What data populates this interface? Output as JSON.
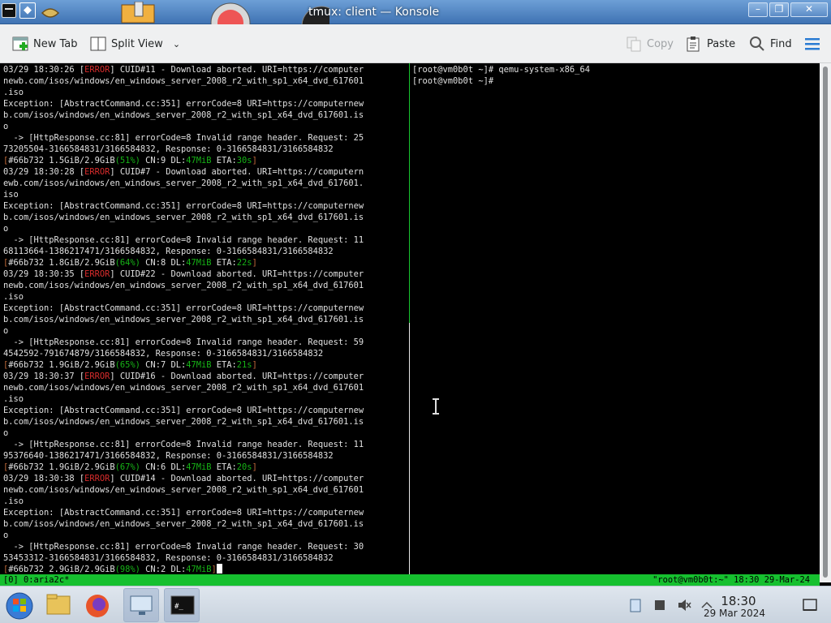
{
  "window": {
    "title": "tmux: client — Konsole"
  },
  "toolbar": {
    "new_tab": "New Tab",
    "split_view": "Split View",
    "copy": "Copy",
    "paste": "Paste",
    "find": "Find"
  },
  "left_pane": {
    "lines": [
      [
        [
          "03/29 18:30:26 [",
          ""
        ],
        [
          "ERROR",
          "err"
        ],
        [
          "] CUID#11 - Download aborted. URI=https://computer",
          ""
        ]
      ],
      [
        [
          "newb.com/isos/windows/en_windows_server_2008_r2_with_sp1_x64_dvd_617601",
          ""
        ]
      ],
      [
        [
          ".iso",
          ""
        ]
      ],
      [
        [
          "Exception: [AbstractCommand.cc:351] errorCode=8 URI=https://computernew",
          ""
        ]
      ],
      [
        [
          "b.com/isos/windows/en_windows_server_2008_r2_with_sp1_x64_dvd_617601.is",
          ""
        ]
      ],
      [
        [
          "o",
          ""
        ]
      ],
      [
        [
          "  -> [HttpResponse.cc:81] errorCode=8 Invalid range header. Request: 25",
          ""
        ]
      ],
      [
        [
          "73205504-3166584831/3166584832, Response: 0-3166584831/3166584832",
          ""
        ]
      ],
      [
        [
          "[",
          "br"
        ],
        [
          "#66b732 1.5GiB/2.9GiB",
          ""
        ],
        [
          "(51%)",
          "grn"
        ],
        [
          " CN:9 DL:",
          ""
        ],
        [
          "47MiB",
          "grn"
        ],
        [
          " ETA:",
          ""
        ],
        [
          "30s",
          "grn"
        ],
        [
          "]",
          "br"
        ]
      ],
      [
        [
          "03/29 18:30:28 [",
          ""
        ],
        [
          "ERROR",
          "err"
        ],
        [
          "] CUID#7 - Download aborted. URI=https://computern",
          ""
        ]
      ],
      [
        [
          "ewb.com/isos/windows/en_windows_server_2008_r2_with_sp1_x64_dvd_617601.",
          ""
        ]
      ],
      [
        [
          "iso",
          ""
        ]
      ],
      [
        [
          "Exception: [AbstractCommand.cc:351] errorCode=8 URI=https://computernew",
          ""
        ]
      ],
      [
        [
          "b.com/isos/windows/en_windows_server_2008_r2_with_sp1_x64_dvd_617601.is",
          ""
        ]
      ],
      [
        [
          "o",
          ""
        ]
      ],
      [
        [
          "  -> [HttpResponse.cc:81] errorCode=8 Invalid range header. Request: 11",
          ""
        ]
      ],
      [
        [
          "68113664-1386217471/3166584832, Response: 0-3166584831/3166584832",
          ""
        ]
      ],
      [
        [
          "[",
          "br"
        ],
        [
          "#66b732 1.8GiB/2.9GiB",
          ""
        ],
        [
          "(64%)",
          "grn"
        ],
        [
          " CN:8 DL:",
          ""
        ],
        [
          "47MiB",
          "grn"
        ],
        [
          " ETA:",
          ""
        ],
        [
          "22s",
          "grn"
        ],
        [
          "]",
          "br"
        ]
      ],
      [
        [
          "03/29 18:30:35 [",
          ""
        ],
        [
          "ERROR",
          "err"
        ],
        [
          "] CUID#22 - Download aborted. URI=https://computer",
          ""
        ]
      ],
      [
        [
          "newb.com/isos/windows/en_windows_server_2008_r2_with_sp1_x64_dvd_617601",
          ""
        ]
      ],
      [
        [
          ".iso",
          ""
        ]
      ],
      [
        [
          "Exception: [AbstractCommand.cc:351] errorCode=8 URI=https://computernew",
          ""
        ]
      ],
      [
        [
          "b.com/isos/windows/en_windows_server_2008_r2_with_sp1_x64_dvd_617601.is",
          ""
        ]
      ],
      [
        [
          "o",
          ""
        ]
      ],
      [
        [
          "  -> [HttpResponse.cc:81] errorCode=8 Invalid range header. Request: 59",
          ""
        ]
      ],
      [
        [
          "4542592-791674879/3166584832, Response: 0-3166584831/3166584832",
          ""
        ]
      ],
      [
        [
          "[",
          "br"
        ],
        [
          "#66b732 1.9GiB/2.9GiB",
          ""
        ],
        [
          "(65%)",
          "grn"
        ],
        [
          " CN:7 DL:",
          ""
        ],
        [
          "47MiB",
          "grn"
        ],
        [
          " ETA:",
          ""
        ],
        [
          "21s",
          "grn"
        ],
        [
          "]",
          "br"
        ]
      ],
      [
        [
          "03/29 18:30:37 [",
          ""
        ],
        [
          "ERROR",
          "err"
        ],
        [
          "] CUID#16 - Download aborted. URI=https://computer",
          ""
        ]
      ],
      [
        [
          "newb.com/isos/windows/en_windows_server_2008_r2_with_sp1_x64_dvd_617601",
          ""
        ]
      ],
      [
        [
          ".iso",
          ""
        ]
      ],
      [
        [
          "Exception: [AbstractCommand.cc:351] errorCode=8 URI=https://computernew",
          ""
        ]
      ],
      [
        [
          "b.com/isos/windows/en_windows_server_2008_r2_with_sp1_x64_dvd_617601.is",
          ""
        ]
      ],
      [
        [
          "o",
          ""
        ]
      ],
      [
        [
          "  -> [HttpResponse.cc:81] errorCode=8 Invalid range header. Request: 11",
          ""
        ]
      ],
      [
        [
          "95376640-1386217471/3166584832, Response: 0-3166584831/3166584832",
          ""
        ]
      ],
      [
        [
          "[",
          "br"
        ],
        [
          "#66b732 1.9GiB/2.9GiB",
          ""
        ],
        [
          "(67%)",
          "grn"
        ],
        [
          " CN:6 DL:",
          ""
        ],
        [
          "47MiB",
          "grn"
        ],
        [
          " ETA:",
          ""
        ],
        [
          "20s",
          "grn"
        ],
        [
          "]",
          "br"
        ]
      ],
      [
        [
          "03/29 18:30:38 [",
          ""
        ],
        [
          "ERROR",
          "err"
        ],
        [
          "] CUID#14 - Download aborted. URI=https://computer",
          ""
        ]
      ],
      [
        [
          "newb.com/isos/windows/en_windows_server_2008_r2_with_sp1_x64_dvd_617601",
          ""
        ]
      ],
      [
        [
          ".iso",
          ""
        ]
      ],
      [
        [
          "Exception: [AbstractCommand.cc:351] errorCode=8 URI=https://computernew",
          ""
        ]
      ],
      [
        [
          "b.com/isos/windows/en_windows_server_2008_r2_with_sp1_x64_dvd_617601.is",
          ""
        ]
      ],
      [
        [
          "o",
          ""
        ]
      ],
      [
        [
          "  -> [HttpResponse.cc:81] errorCode=8 Invalid range header. Request: 30",
          ""
        ]
      ],
      [
        [
          "53453312-3166584831/3166584832, Response: 0-3166584831/3166584832",
          ""
        ]
      ],
      [
        [
          "[",
          "br"
        ],
        [
          "#66b732 2.9GiB/2.9GiB",
          ""
        ],
        [
          "(98%)",
          "grn"
        ],
        [
          " CN:2 DL:",
          ""
        ],
        [
          "47MiB",
          "grn"
        ],
        [
          "]",
          "br"
        ]
      ]
    ]
  },
  "right_pane": {
    "lines": [
      "[root@vm0b0t ~]# qemu-system-x86_64",
      "[root@vm0b0t ~]# "
    ]
  },
  "tmux": {
    "left": "[0] 0:aria2c*",
    "right": "\"root@vm0b0t:~\" 18:30 29-Mar-24"
  },
  "taskbar": {
    "time": "18:30",
    "date": "29 Mar 2024"
  },
  "colors": {
    "error": "#d92c2c",
    "green": "#16b316",
    "tmux_bar": "#16c02f"
  }
}
